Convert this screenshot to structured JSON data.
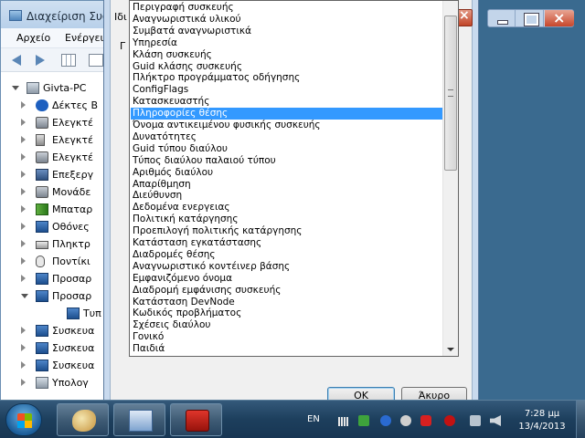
{
  "background_window": {
    "title": "Διαχείριση Συσκ",
    "menu": [
      "Αρχείο",
      "Ενέργεια"
    ],
    "tree": [
      {
        "label": "Givta-PC",
        "icon": "computer-icon"
      },
      {
        "label": "Δέκτες Β",
        "icon": "bluetooth-icon"
      },
      {
        "label": "Ελεγκτέ",
        "icon": "disk-controller-icon"
      },
      {
        "label": "Ελεγκτέ",
        "icon": "usb-icon"
      },
      {
        "label": "Ελεγκτέ",
        "icon": "storage-controller-icon"
      },
      {
        "label": "Επεξεργ",
        "icon": "processor-icon"
      },
      {
        "label": "Μονάδε",
        "icon": "disk-drive-icon"
      },
      {
        "label": "Μπαταρ",
        "icon": "battery-icon"
      },
      {
        "label": "Οθόνες",
        "icon": "monitor-icon"
      },
      {
        "label": "Πληκτρ",
        "icon": "keyboard-icon"
      },
      {
        "label": "Ποντίκι",
        "icon": "mouse-icon"
      },
      {
        "label": "Προσαρ",
        "icon": "display-adapter-icon"
      },
      {
        "label": "Προσαρ",
        "icon": "network-adapter-icon"
      },
      {
        "label": "Τυπ",
        "icon": "network-device-icon"
      },
      {
        "label": "Συσκευα",
        "icon": "device-icon"
      },
      {
        "label": "Συσκευα",
        "icon": "device-icon"
      },
      {
        "label": "Συσκευα",
        "icon": "device-icon"
      },
      {
        "label": "Υπολογ",
        "icon": "computer-icon"
      }
    ]
  },
  "dialog": {
    "tab_fragment": "Ιδι",
    "label_fragment": "Γ",
    "ok_label": "OK",
    "cancel_label": "Άκυρο"
  },
  "dropdown": {
    "selected_index": 9,
    "items": [
      "Περιγραφή συσκευής",
      "Αναγνωριστικά υλικού",
      "Συμβατά αναγνωριστικά",
      "Υπηρεσία",
      "Κλάση συσκευής",
      "Guid κλάσης συσκευής",
      "Πλήκτρο προγράμματος οδήγησης",
      "ConfigFlags",
      "Κατασκευαστής",
      "Πληροφορίες θέσης",
      "Όνομα αντικειμένου φυσικής συσκευής",
      "Δυνατότητες",
      "Guid τύπου διαύλου",
      "Τύπος διαύλου παλαιού τύπου",
      "Αριθμός διαύλου",
      "Απαρίθμηση",
      "Διεύθυνση",
      "Δεδομένα ενεργειας",
      "Πολιτική κατάργησης",
      "Προεπιλογή πολιτικής κατάργησης",
      "Κατάσταση εγκατάστασης",
      "Διαδρομές θέσης",
      "Αναγνωριστικό κοντέινερ βάσης",
      "Εμφανιζόμενο όνομα",
      "Διαδρομή εμφάνισης συσκευής",
      "Κατάσταση DevNode",
      "Κωδικός προβλήματος",
      "Σχέσεις διαύλου",
      "Γονικό",
      "Παιδιά"
    ]
  },
  "taskbar": {
    "language": "EN",
    "time": "7:28 μμ",
    "date": "13/4/2013"
  }
}
